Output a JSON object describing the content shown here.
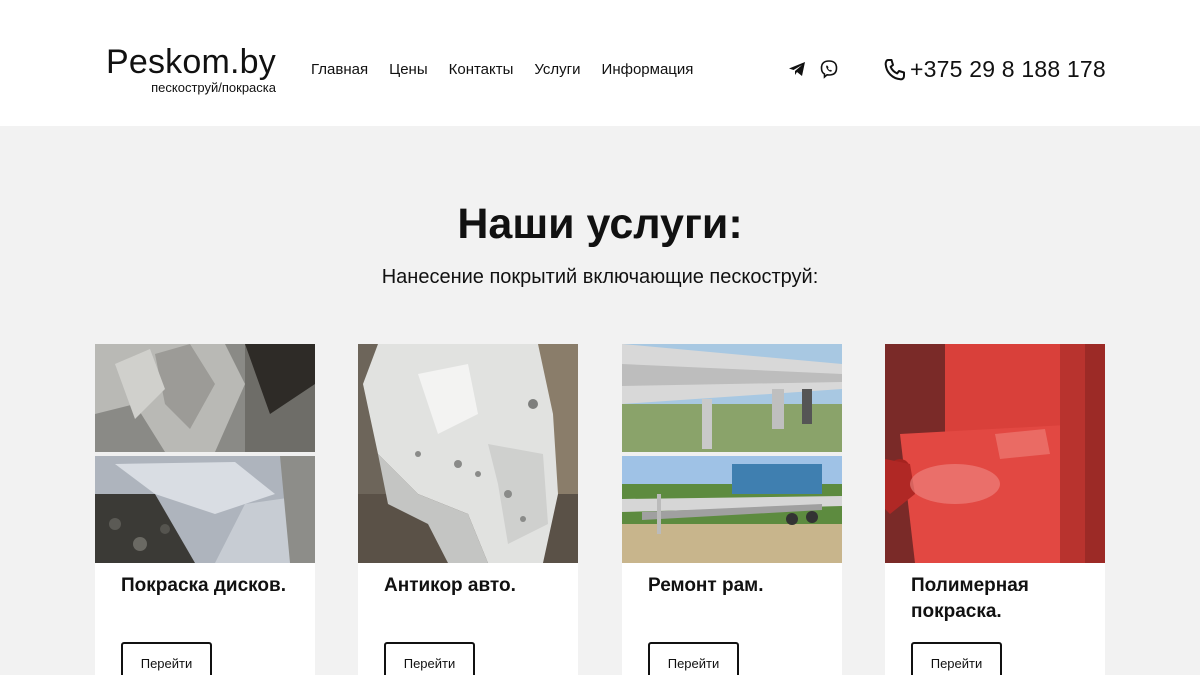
{
  "header": {
    "logo_title": "Peskom.by",
    "logo_subtitle": "пескоструй/покраска",
    "nav": [
      {
        "label": "Главная"
      },
      {
        "label": "Цены"
      },
      {
        "label": "Контакты"
      },
      {
        "label": "Услуги"
      },
      {
        "label": "Информация"
      }
    ],
    "socials": [
      "telegram-icon",
      "viber-icon"
    ],
    "phone": "+375 29 8 188 178"
  },
  "services": {
    "title": "Наши услуги:",
    "subtitle": "Нанесение покрытий включающие пескоструй:",
    "cards": [
      {
        "title": "Покраска дисков.",
        "button": "Перейти"
      },
      {
        "title": "Антикор авто.",
        "button": "Перейти"
      },
      {
        "title": "Ремонт рам.",
        "button": "Перейти"
      },
      {
        "title": "Полимерная покраска.",
        "button": "Перейти"
      }
    ]
  },
  "colors": {
    "header_bg": "#ffffff",
    "page_bg": "#f2f2f2",
    "text": "#111111"
  }
}
